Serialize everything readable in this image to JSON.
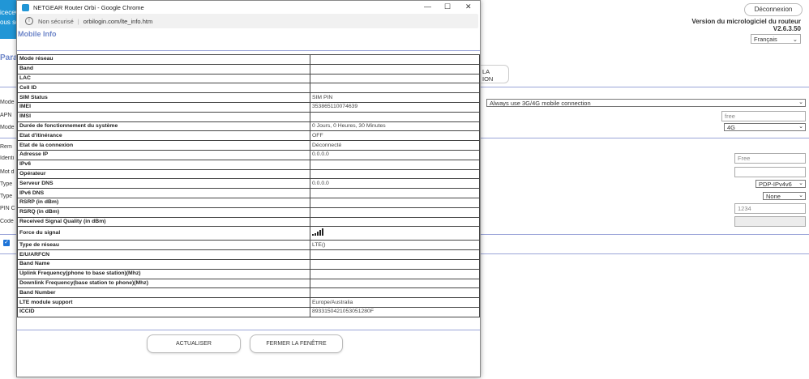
{
  "background": {
    "corner_text_1": "icecev",
    "corner_text_2": "ous so",
    "tab_label": "Para",
    "logout": "Déconnexion",
    "firmware_title": "Version du micrologiciel du routeur",
    "firmware_version": "V2.6.3.50",
    "language": "Français",
    "partial_button": "LA\nION",
    "labels": [
      "Mode",
      "APN",
      "Mode",
      "Rem",
      "Identi",
      "Mot d",
      "Type",
      "Type",
      "PIN C",
      "Code"
    ],
    "connection_mode": "Always use 3G/4G mobile connection",
    "apn_value": "free",
    "network_mode": "4G",
    "identifier_value": "Free",
    "pdp_type": "PDP-IPv4v6",
    "auth_type": "None",
    "pin_value": "1234"
  },
  "popup": {
    "window_title": "NETGEAR Router Orbi - Google Chrome",
    "security_label": "Non sécurisé",
    "url": "orbilogin.com/lte_info.htm",
    "page_title": "Mobile Info",
    "rows": [
      {
        "label": "Mode réseau",
        "value": ""
      },
      {
        "label": "Band",
        "value": ""
      },
      {
        "label": "LAC",
        "value": ""
      },
      {
        "label": "Cell ID",
        "value": ""
      },
      {
        "label": "SIM Status",
        "value": "SIM PIN"
      },
      {
        "label": "IMEI",
        "value": "353865110074639"
      },
      {
        "label": "IMSI",
        "value": ""
      },
      {
        "label": "Durée de fonctionnement du système",
        "value": "0 Jours, 0 Heures, 30 Minutes"
      },
      {
        "label": "Etat d'itinérance",
        "value": "OFF"
      },
      {
        "label": "Etat de la connexion",
        "value": "Déconnecté"
      },
      {
        "label": "Adresse IP",
        "value": "0.0.0.0"
      },
      {
        "label": "IPv6",
        "value": ""
      },
      {
        "label": "Opérateur",
        "value": ""
      },
      {
        "label": "Serveur DNS",
        "value": "0.0.0.0"
      },
      {
        "label": "IPv6 DNS",
        "value": ""
      },
      {
        "label": "RSRP (in dBm)",
        "value": ""
      },
      {
        "label": "RSRQ (in dBm)",
        "value": ""
      },
      {
        "label": "Received Signal Quality (in dBm)",
        "value": ""
      },
      {
        "label": "Force du signal",
        "value": ""
      },
      {
        "label": "Type de réseau",
        "value": "LTE()"
      },
      {
        "label": "E/U/ARFCN",
        "value": ""
      },
      {
        "label": "Band Name",
        "value": ""
      },
      {
        "label": "Uplink Frequency(phone to base station)(Mhz)",
        "value": ""
      },
      {
        "label": "Downlink Frequency(base station to phone)(Mhz)",
        "value": ""
      },
      {
        "label": "Band Number",
        "value": ""
      },
      {
        "label": "LTE module support",
        "value": "Europe/Australia"
      },
      {
        "label": "ICCID",
        "value": "8933150421053051280F"
      }
    ],
    "refresh_button": "ACTUALISER",
    "close_button": "FERMER LA FENÊTRE"
  }
}
